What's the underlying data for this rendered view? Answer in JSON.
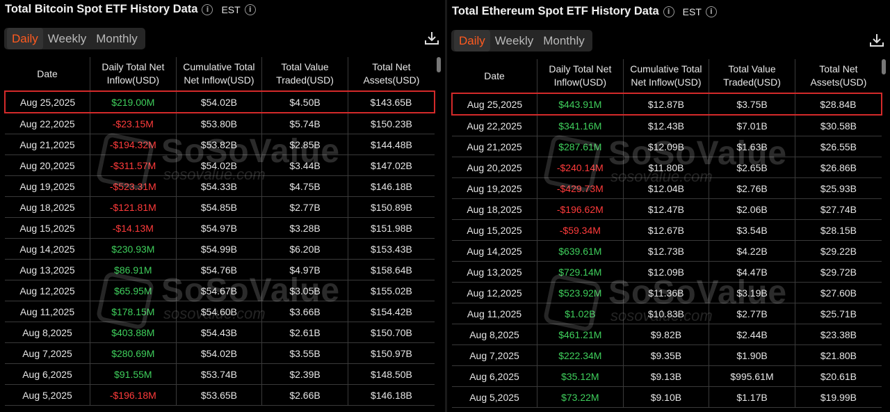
{
  "colors": {
    "accent": "#ff5a1f",
    "positive": "#3fcf5c",
    "negative": "#ff3b3b",
    "highlight": "#d42a2a"
  },
  "watermark": {
    "brand": "SoSoValue",
    "site": "sosovalue.com"
  },
  "btc": {
    "title": "Total Bitcoin Spot ETF History Data",
    "timezone": "EST",
    "tabs": [
      "Daily",
      "Weekly",
      "Monthly"
    ],
    "active_tab": "Daily",
    "headers": [
      "Date",
      "Daily Total Net Inflow(USD)",
      "Cumulative Total Net Inflow(USD)",
      "Total Value Traded(USD)",
      "Total Net Assets(USD)"
    ],
    "rows": [
      [
        "Aug 25,2025",
        "$219.00M",
        "$54.02B",
        "$4.50B",
        "$143.65B"
      ],
      [
        "Aug 22,2025",
        "-$23.15M",
        "$53.80B",
        "$5.74B",
        "$150.23B"
      ],
      [
        "Aug 21,2025",
        "-$194.32M",
        "$53.82B",
        "$2.85B",
        "$144.48B"
      ],
      [
        "Aug 20,2025",
        "-$311.57M",
        "$54.02B",
        "$3.44B",
        "$147.02B"
      ],
      [
        "Aug 19,2025",
        "-$523.31M",
        "$54.33B",
        "$4.75B",
        "$146.18B"
      ],
      [
        "Aug 18,2025",
        "-$121.81M",
        "$54.85B",
        "$2.77B",
        "$150.89B"
      ],
      [
        "Aug 15,2025",
        "-$14.13M",
        "$54.97B",
        "$3.28B",
        "$151.98B"
      ],
      [
        "Aug 14,2025",
        "$230.93M",
        "$54.99B",
        "$6.20B",
        "$153.43B"
      ],
      [
        "Aug 13,2025",
        "$86.91M",
        "$54.76B",
        "$4.97B",
        "$158.64B"
      ],
      [
        "Aug 12,2025",
        "$65.95M",
        "$54.67B",
        "$3.05B",
        "$155.02B"
      ],
      [
        "Aug 11,2025",
        "$178.15M",
        "$54.60B",
        "$3.66B",
        "$154.42B"
      ],
      [
        "Aug 8,2025",
        "$403.88M",
        "$54.43B",
        "$2.61B",
        "$150.70B"
      ],
      [
        "Aug 7,2025",
        "$280.69M",
        "$54.02B",
        "$3.55B",
        "$150.97B"
      ],
      [
        "Aug 6,2025",
        "$91.55M",
        "$53.74B",
        "$2.39B",
        "$148.50B"
      ],
      [
        "Aug 5,2025",
        "-$196.18M",
        "$53.65B",
        "$2.66B",
        "$146.18B"
      ]
    ]
  },
  "eth": {
    "title": "Total Ethereum Spot ETF History Data",
    "timezone": "EST",
    "tabs": [
      "Daily",
      "Weekly",
      "Monthly"
    ],
    "active_tab": "Daily",
    "headers": [
      "Date",
      "Daily Total Net Inflow(USD)",
      "Cumulative Total Net Inflow(USD)",
      "Total Value Traded(USD)",
      "Total Net Assets(USD)"
    ],
    "rows": [
      [
        "Aug 25,2025",
        "$443.91M",
        "$12.87B",
        "$3.75B",
        "$28.84B"
      ],
      [
        "Aug 22,2025",
        "$341.16M",
        "$12.43B",
        "$7.01B",
        "$30.58B"
      ],
      [
        "Aug 21,2025",
        "$287.61M",
        "$12.09B",
        "$1.63B",
        "$26.55B"
      ],
      [
        "Aug 20,2025",
        "-$240.14M",
        "$11.80B",
        "$2.65B",
        "$26.86B"
      ],
      [
        "Aug 19,2025",
        "-$429.73M",
        "$12.04B",
        "$2.76B",
        "$25.93B"
      ],
      [
        "Aug 18,2025",
        "-$196.62M",
        "$12.47B",
        "$2.06B",
        "$27.74B"
      ],
      [
        "Aug 15,2025",
        "-$59.34M",
        "$12.67B",
        "$3.54B",
        "$28.15B"
      ],
      [
        "Aug 14,2025",
        "$639.61M",
        "$12.73B",
        "$4.22B",
        "$29.22B"
      ],
      [
        "Aug 13,2025",
        "$729.14M",
        "$12.09B",
        "$4.47B",
        "$29.72B"
      ],
      [
        "Aug 12,2025",
        "$523.92M",
        "$11.36B",
        "$3.19B",
        "$27.60B"
      ],
      [
        "Aug 11,2025",
        "$1.02B",
        "$10.83B",
        "$2.77B",
        "$25.71B"
      ],
      [
        "Aug 8,2025",
        "$461.21M",
        "$9.82B",
        "$2.44B",
        "$23.38B"
      ],
      [
        "Aug 7,2025",
        "$222.34M",
        "$9.35B",
        "$1.90B",
        "$21.80B"
      ],
      [
        "Aug 6,2025",
        "$35.12M",
        "$9.13B",
        "$995.61M",
        "$20.61B"
      ],
      [
        "Aug 5,2025",
        "$73.22M",
        "$9.10B",
        "$1.17B",
        "$19.99B"
      ]
    ]
  }
}
